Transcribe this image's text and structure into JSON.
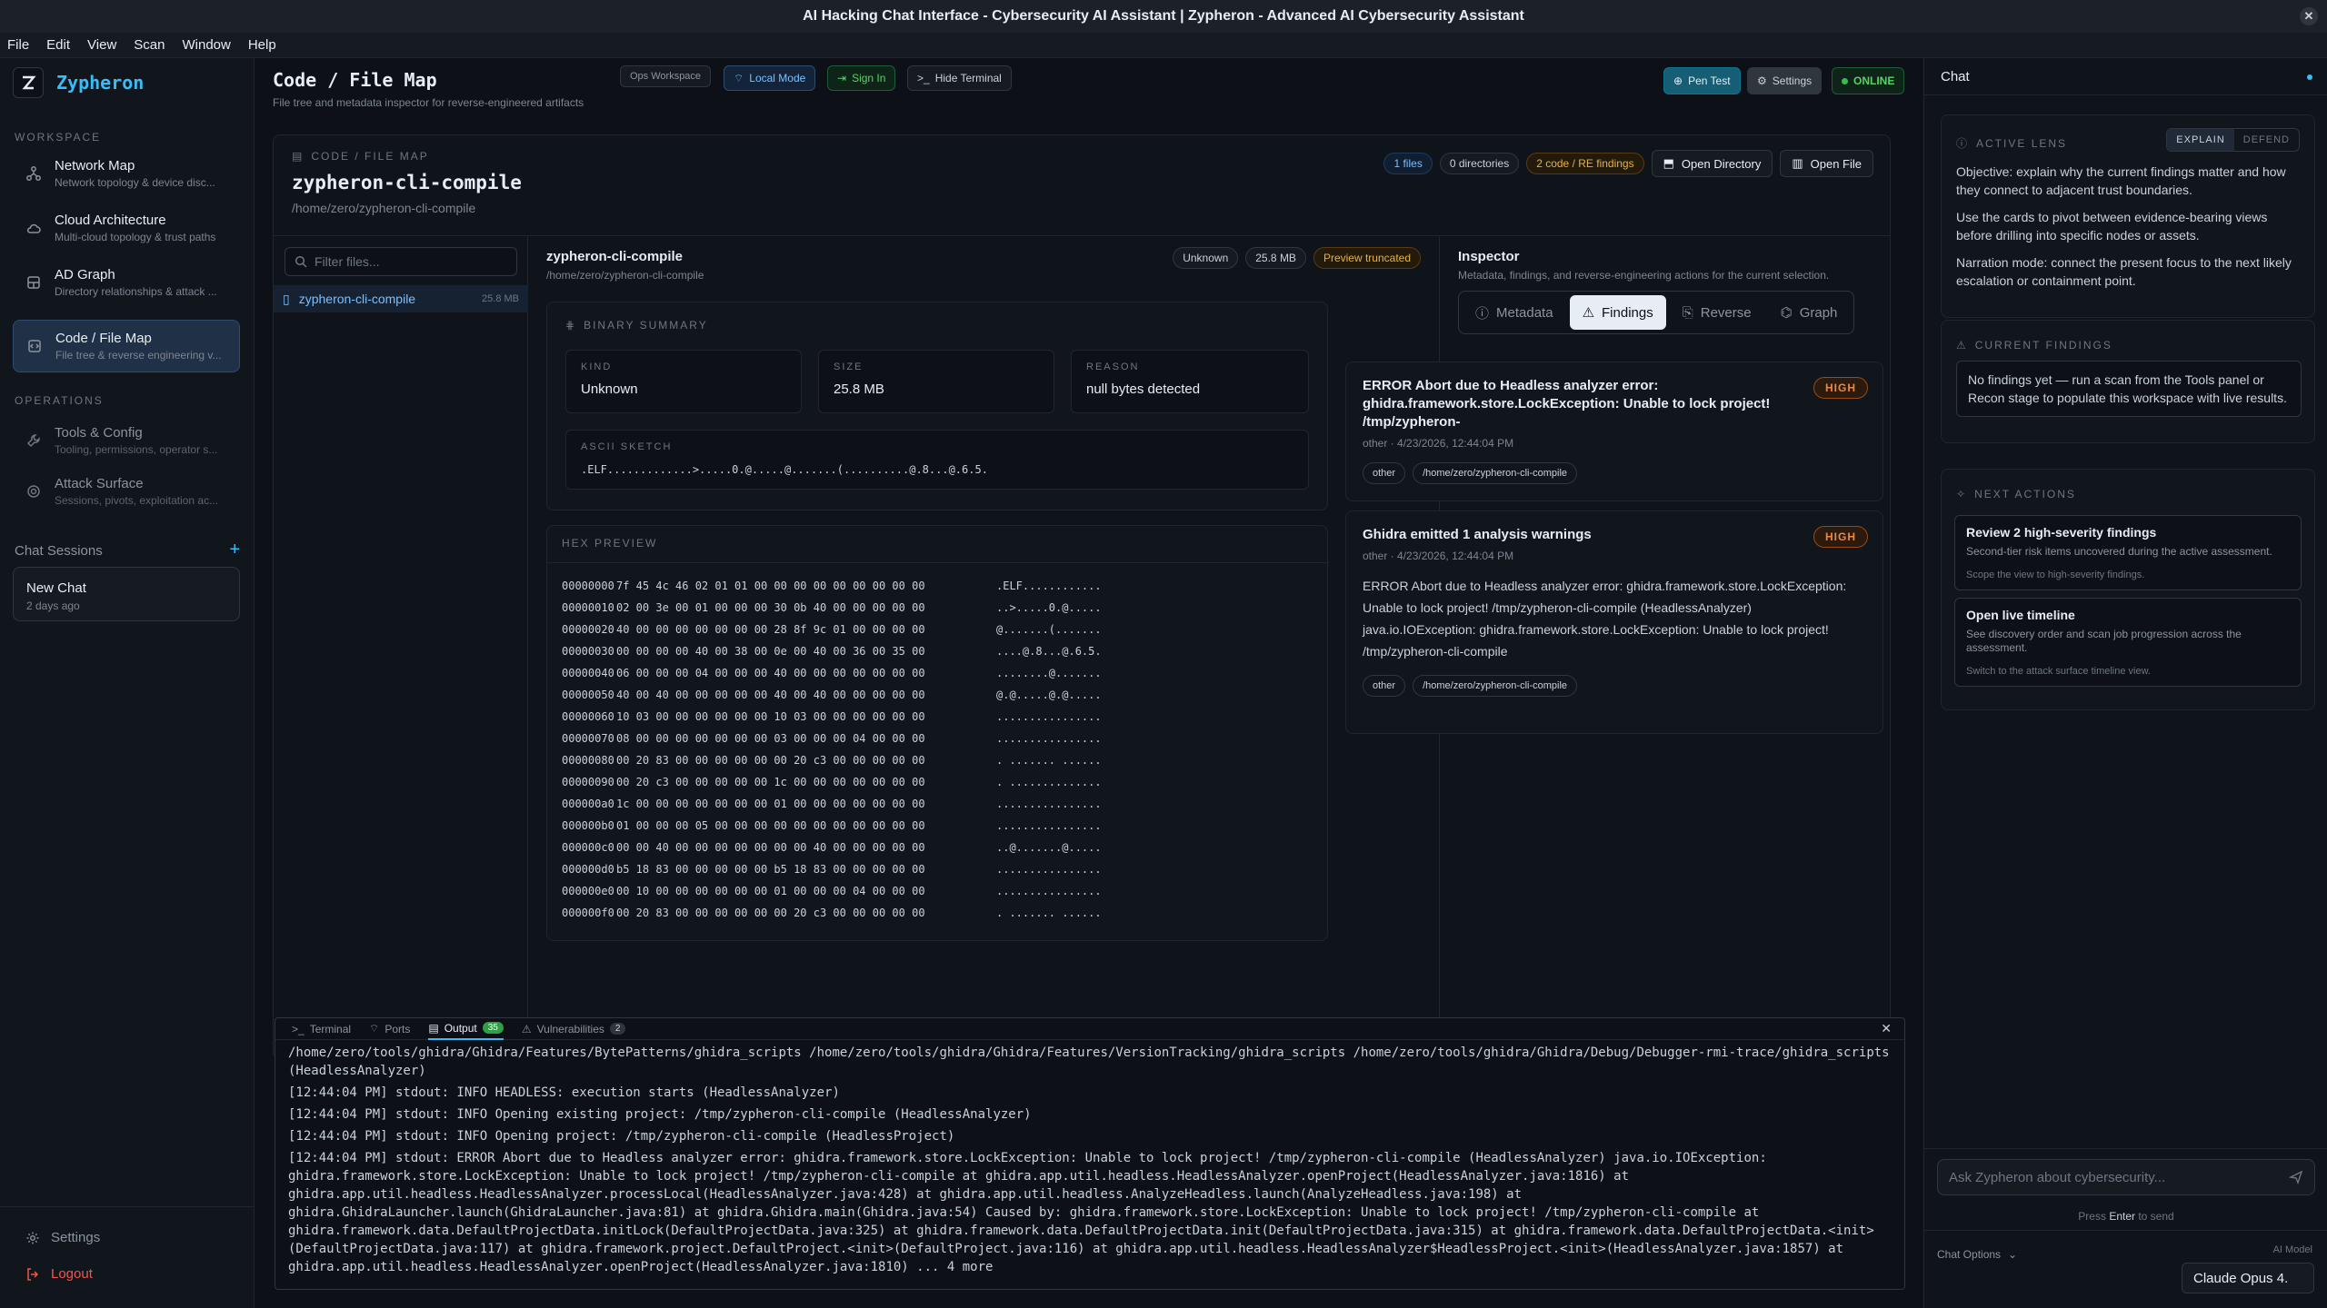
{
  "window": {
    "title": "AI Hacking Chat Interface - Cybersecurity AI Assistant | Zypheron - Advanced AI Cybersecurity Assistant"
  },
  "menu": [
    "File",
    "Edit",
    "View",
    "Scan",
    "Window",
    "Help"
  ],
  "sidebar": {
    "brand": "Zypheron",
    "workspace_label": "WORKSPACE",
    "workspace_items": [
      {
        "label": "Network Map",
        "sub": "Network topology & device disc...",
        "icon": "network-icon"
      },
      {
        "label": "Cloud Architecture",
        "sub": "Multi-cloud topology & trust paths",
        "icon": "cloud-icon"
      },
      {
        "label": "AD Graph",
        "sub": "Directory relationships & attack ...",
        "icon": "database-icon"
      },
      {
        "label": "Code / File Map",
        "sub": "File tree & reverse engineering v...",
        "icon": "code-icon"
      }
    ],
    "operations_label": "OPERATIONS",
    "operations_items": [
      {
        "label": "Tools & Config",
        "sub": "Tooling, permissions, operator s...",
        "icon": "wrench-icon"
      },
      {
        "label": "Attack Surface",
        "sub": "Sessions, pivots, exploitation ac...",
        "icon": "target-icon"
      }
    ],
    "chat_sessions_label": "Chat Sessions",
    "chat_session": {
      "title": "New Chat",
      "date": "2 days ago"
    },
    "settings": "Settings",
    "logout": "Logout"
  },
  "header": {
    "title": "Code / File Map",
    "subtitle": "File tree and metadata inspector for reverse-engineered artifacts",
    "pills": {
      "workspace": "Ops Workspace",
      "local": "Local Mode",
      "signin": "Sign In",
      "terminal": "Hide Terminal"
    },
    "right": {
      "pentest": "Pen Test",
      "settings": "Settings",
      "online": "ONLINE"
    }
  },
  "filemap": {
    "kicker": "CODE / FILE MAP",
    "name": "zypheron-cli-compile",
    "path": "/home/zero/zypheron-cli-compile",
    "badges": {
      "files": "1 files",
      "dirs": "0 directories",
      "findings": "2 code / RE findings"
    },
    "open_directory": "Open Directory",
    "open_file": "Open File",
    "filter_placeholder": "Filter files...",
    "file": {
      "name": "zypheron-cli-compile",
      "size": "25.8 MB"
    }
  },
  "detail": {
    "name": "zypheron-cli-compile",
    "path": "/home/zero/zypheron-cli-compile",
    "badges": {
      "kind": "Unknown",
      "size": "25.8 MB",
      "preview": "Preview truncated"
    },
    "binary_summary_label": "BINARY SUMMARY",
    "kind_label": "KIND",
    "kind": "Unknown",
    "size_label": "SIZE",
    "size": "25.8 MB",
    "reason_label": "REASON",
    "reason": "null bytes detected",
    "ascii_label": "ASCII SKETCH",
    "ascii": ".ELF.............>.....0.@.....@.......(..........@.8...@.6.5.",
    "hex_label": "HEX PREVIEW",
    "hex": [
      {
        "o": "00000000",
        "b": "7f 45 4c 46 02 01 01 00 00 00 00 00 00 00 00 00",
        "a": ".ELF............"
      },
      {
        "o": "00000010",
        "b": "02 00 3e 00 01 00 00 00 30 0b 40 00 00 00 00 00",
        "a": "..>.....0.@....."
      },
      {
        "o": "00000020",
        "b": "40 00 00 00 00 00 00 00 28 8f 9c 01 00 00 00 00",
        "a": "@.......(......."
      },
      {
        "o": "00000030",
        "b": "00 00 00 00 40 00 38 00 0e 00 40 00 36 00 35 00",
        "a": "....@.8...@.6.5."
      },
      {
        "o": "00000040",
        "b": "06 00 00 00 04 00 00 00 40 00 00 00 00 00 00 00",
        "a": "........@......."
      },
      {
        "o": "00000050",
        "b": "40 00 40 00 00 00 00 00 40 00 40 00 00 00 00 00",
        "a": "@.@.....@.@....."
      },
      {
        "o": "00000060",
        "b": "10 03 00 00 00 00 00 00 10 03 00 00 00 00 00 00",
        "a": "................"
      },
      {
        "o": "00000070",
        "b": "08 00 00 00 00 00 00 00 03 00 00 00 04 00 00 00",
        "a": "................"
      },
      {
        "o": "00000080",
        "b": "00 20 83 00 00 00 00 00 00 20 c3 00 00 00 00 00",
        "a": ". ....... ......"
      },
      {
        "o": "00000090",
        "b": "00 20 c3 00 00 00 00 00 1c 00 00 00 00 00 00 00",
        "a": ". .............."
      },
      {
        "o": "000000a0",
        "b": "1c 00 00 00 00 00 00 00 01 00 00 00 00 00 00 00",
        "a": "................"
      },
      {
        "o": "000000b0",
        "b": "01 00 00 00 05 00 00 00 00 00 00 00 00 00 00 00",
        "a": "................"
      },
      {
        "o": "000000c0",
        "b": "00 00 40 00 00 00 00 00 00 00 40 00 00 00 00 00",
        "a": "..@.......@....."
      },
      {
        "o": "000000d0",
        "b": "b5 18 83 00 00 00 00 00 b5 18 83 00 00 00 00 00",
        "a": "................"
      },
      {
        "o": "000000e0",
        "b": "00 10 00 00 00 00 00 00 01 00 00 00 04 00 00 00",
        "a": "................"
      },
      {
        "o": "000000f0",
        "b": "00 20 83 00 00 00 00 00 00 20 c3 00 00 00 00 00",
        "a": ". ....... ......"
      }
    ]
  },
  "inspector": {
    "title": "Inspector",
    "subtitle": "Metadata, findings, and reverse-engineering actions for the current selection.",
    "tabs": [
      "Metadata",
      "Findings",
      "Reverse",
      "Graph"
    ],
    "findings": [
      {
        "title": "ERROR Abort due to Headless analyzer error: ghidra.framework.store.LockException: Unable to lock project! /tmp/zypheron-",
        "meta": "other · 4/23/2026, 12:44:04 PM",
        "severity": "HIGH",
        "body": "",
        "tags": [
          "other",
          "/home/zero/zypheron-cli-compile"
        ]
      },
      {
        "title": "Ghidra emitted 1 analysis warnings",
        "meta": "other · 4/23/2026, 12:44:04 PM",
        "severity": "HIGH",
        "body": "ERROR Abort due to Headless analyzer error: ghidra.framework.store.LockException: Unable to lock project! /tmp/zypheron-cli-compile (HeadlessAnalyzer) java.io.IOException: ghidra.framework.store.LockException: Unable to lock project! /tmp/zypheron-cli-compile",
        "tags": [
          "other",
          "/home/zero/zypheron-cli-compile"
        ]
      }
    ]
  },
  "bottom": {
    "tabs": {
      "terminal": "Terminal",
      "ports": "Ports",
      "output": "Output",
      "output_count": "35",
      "vulns": "Vulnerabilities",
      "vulns_count": "2"
    },
    "log": [
      "/home/zero/tools/ghidra/Ghidra/Features/BytePatterns/ghidra_scripts /home/zero/tools/ghidra/Ghidra/Features/VersionTracking/ghidra_scripts /home/zero/tools/ghidra/Ghidra/Debug/Debugger-rmi-trace/ghidra_scripts (HeadlessAnalyzer)",
      "[12:44:04 PM] stdout: INFO HEADLESS: execution starts (HeadlessAnalyzer)",
      "[12:44:04 PM] stdout: INFO Opening existing project: /tmp/zypheron-cli-compile (HeadlessAnalyzer)",
      "[12:44:04 PM] stdout: INFO Opening project: /tmp/zypheron-cli-compile (HeadlessProject)",
      "[12:44:04 PM] stdout: ERROR Abort due to Headless analyzer error: ghidra.framework.store.LockException: Unable to lock project! /tmp/zypheron-cli-compile (HeadlessAnalyzer) java.io.IOException: ghidra.framework.store.LockException: Unable to lock project! /tmp/zypheron-cli-compile at ghidra.app.util.headless.HeadlessAnalyzer.openProject(HeadlessAnalyzer.java:1816) at ghidra.app.util.headless.HeadlessAnalyzer.processLocal(HeadlessAnalyzer.java:428) at ghidra.app.util.headless.AnalyzeHeadless.launch(AnalyzeHeadless.java:198) at ghidra.GhidraLauncher.launch(GhidraLauncher.java:81) at ghidra.Ghidra.main(Ghidra.java:54) Caused by: ghidra.framework.store.LockException: Unable to lock project! /tmp/zypheron-cli-compile at ghidra.framework.data.DefaultProjectData.initLock(DefaultProjectData.java:325) at ghidra.framework.data.DefaultProjectData.init(DefaultProjectData.java:315) at ghidra.framework.data.DefaultProjectData.<init>(DefaultProjectData.java:117) at ghidra.framework.project.DefaultProject.<init>(DefaultProject.java:116) at ghidra.app.util.headless.HeadlessAnalyzer$HeadlessProject.<init>(HeadlessAnalyzer.java:1857) at ghidra.app.util.headless.HeadlessAnalyzer.openProject(HeadlessAnalyzer.java:1810) ... 4 more"
    ]
  },
  "chat": {
    "title": "Chat",
    "lens_label": "ACTIVE LENS",
    "lens_modes": [
      "EXPLAIN",
      "DEFEND"
    ],
    "lens_paras": [
      "Objective: explain why the current findings matter and how they connect to adjacent trust boundaries.",
      "Use the cards to pivot between evidence-bearing views before drilling into specific nodes or assets.",
      "Narration mode: connect the present focus to the next likely escalation or containment point."
    ],
    "findings_label": "CURRENT FINDINGS",
    "findings_text": "No findings yet — run a scan from the Tools panel or Recon stage to populate this workspace with live results.",
    "next_label": "NEXT ACTIONS",
    "next_actions": [
      {
        "title": "Review 2 high-severity findings",
        "desc": "Second-tier risk items uncovered during the active assessment.",
        "hint": "Scope the view to high-severity findings."
      },
      {
        "title": "Open live timeline",
        "desc": "See discovery order and scan job progression across the assessment.",
        "hint": "Switch to the attack surface timeline view."
      }
    ],
    "input_placeholder": "Ask Zypheron about cybersecurity...",
    "press_hint_a": "Press",
    "press_hint_key": "Enter",
    "press_hint_b": "to send",
    "options": "Chat Options",
    "model_label": "AI Model",
    "model": "Claude Opus 4."
  },
  "colors": {
    "accent": "#38bdf8",
    "online": "#3fb950",
    "high": "#f0883e"
  }
}
